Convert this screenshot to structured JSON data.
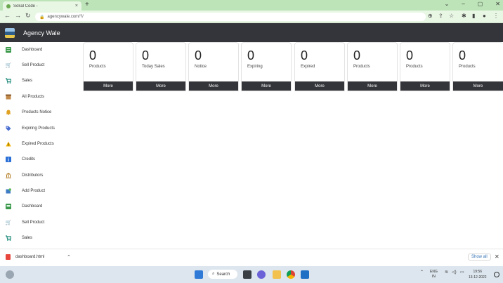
{
  "browser": {
    "tab_title": "Sokal Code -",
    "tab_close": "×",
    "new_tab": "+",
    "url": "agencywale.com/?/",
    "window_controls": [
      "⌄",
      "–",
      "▢",
      "✕"
    ]
  },
  "app": {
    "brand": "Agency Wale"
  },
  "sidebar": {
    "items": [
      {
        "label": "Dashboard",
        "icon": "dashboard-icon",
        "color": "#3a9a4a"
      },
      {
        "label": "Sell Product",
        "icon": "cart-icon",
        "color": "#2f8f6a"
      },
      {
        "label": "Sales",
        "icon": "cart-icon",
        "color": "#1e8a7a"
      },
      {
        "label": "All Products",
        "icon": "box-icon",
        "color": "#8a5a2b"
      },
      {
        "label": "Products Notice",
        "icon": "bell-icon",
        "color": "#e0a020"
      },
      {
        "label": "Expiring Products",
        "icon": "tag-icon",
        "color": "#4a6fd0"
      },
      {
        "label": "Expired Products",
        "icon": "warning-icon",
        "color": "#f2b400"
      },
      {
        "label": "Credits",
        "icon": "info-icon",
        "color": "#2a6fd6"
      },
      {
        "label": "Distributors",
        "icon": "bank-icon",
        "color": "#b07a1e"
      },
      {
        "label": "Add Product",
        "icon": "add-box-icon",
        "color": "#3e7bc4"
      },
      {
        "label": "Dashboard",
        "icon": "dashboard-icon",
        "color": "#3a9a4a"
      },
      {
        "label": "Sell Product",
        "icon": "cart-icon",
        "color": "#2f8f6a"
      },
      {
        "label": "Sales",
        "icon": "cart-icon",
        "color": "#1e8a7a"
      }
    ]
  },
  "cards": [
    {
      "value": "0",
      "label": "Products",
      "more": "More"
    },
    {
      "value": "0",
      "label": "Today Sales",
      "more": "More"
    },
    {
      "value": "0",
      "label": "Notice",
      "more": "More"
    },
    {
      "value": "0",
      "label": "Expiring",
      "more": "More"
    },
    {
      "value": "0",
      "label": "Expired",
      "more": "More"
    },
    {
      "value": "0",
      "label": "Products",
      "more": "More"
    },
    {
      "value": "0",
      "label": "Products",
      "more": "More"
    },
    {
      "value": "0",
      "label": "Products",
      "more": "More"
    }
  ],
  "download_bar": {
    "file": "dashboard.html",
    "show_all": "Show all",
    "close": "✕"
  },
  "taskbar": {
    "search": "Search",
    "lang": "ENG",
    "region": "IN",
    "time": "19:56",
    "date": "13-12-2022"
  },
  "colors": {
    "header_bg": "#34353a",
    "chrome_green": "#bde4b8"
  }
}
